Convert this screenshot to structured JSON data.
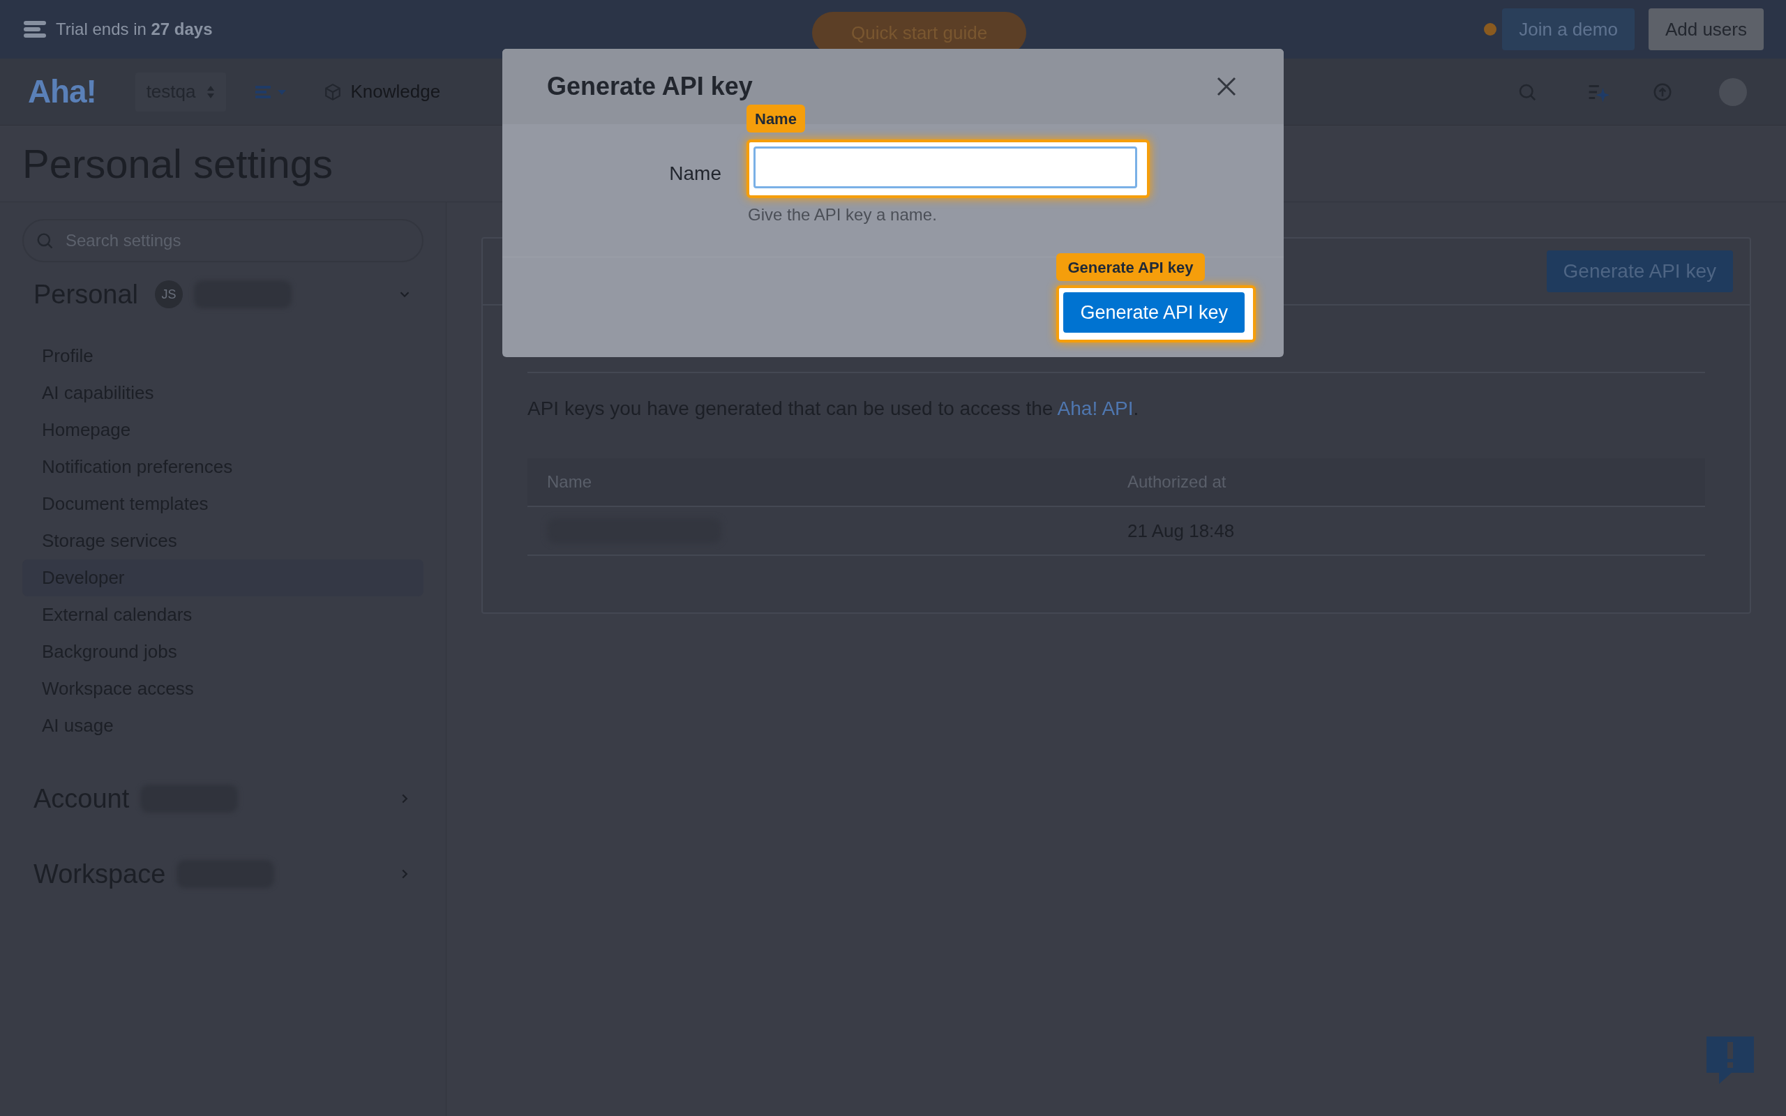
{
  "top_bar": {
    "trial": "Trial ends in **27 days**",
    "quick_start": "Quick start guide",
    "join_demo": "Join a demo",
    "add_users": "Add users"
  },
  "nav": {
    "logo": "Aha!",
    "workspace": "testqa",
    "knowledge": "Knowledge"
  },
  "page_title": "Personal settings",
  "sidebar": {
    "search_placeholder": "Search settings",
    "sections": [
      {
        "title": "Personal",
        "expanded": true,
        "avatar": "JS",
        "items": [
          {
            "label": "Profile",
            "selected": false
          },
          {
            "label": "AI capabilities",
            "selected": false
          },
          {
            "label": "Homepage",
            "selected": false
          },
          {
            "label": "Notification preferences",
            "selected": false
          },
          {
            "label": "Document templates",
            "selected": false
          },
          {
            "label": "Storage services",
            "selected": false
          },
          {
            "label": "Developer",
            "selected": true
          },
          {
            "label": "External calendars",
            "selected": false
          },
          {
            "label": "Background jobs",
            "selected": false
          },
          {
            "label": "Workspace access",
            "selected": false
          },
          {
            "label": "AI usage",
            "selected": false
          }
        ]
      },
      {
        "title": "Account",
        "expanded": false
      },
      {
        "title": "Workspace",
        "expanded": false
      }
    ]
  },
  "content": {
    "generate_button": "Generate API key",
    "description": "API keys you have generated that can be used to access the",
    "link": "Aha! API",
    "description_end": ".",
    "table": {
      "columns": [
        "Name",
        "Authorized at"
      ],
      "rows": [
        {
          "authorized_at": "21 Aug 18:48"
        }
      ]
    }
  },
  "modal": {
    "title": "Generate API key",
    "field_label": "Name",
    "hint": "Give the API key a name.",
    "submit": "Generate API key",
    "field_annotation": "Name",
    "submit_annotation": "Generate API key"
  }
}
